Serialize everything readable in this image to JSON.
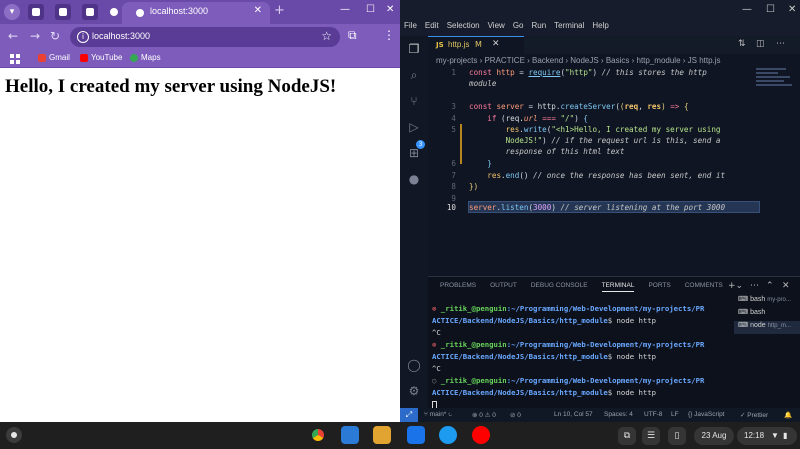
{
  "browser": {
    "tab_title": "localhost:3000",
    "new_tab": "+",
    "url": "localhost:3000",
    "bookmarks": [
      {
        "label": "Gmail",
        "color": "#ea4335"
      },
      {
        "label": "YouTube",
        "color": "#ff0000"
      },
      {
        "label": "Maps",
        "color": "#34a853"
      }
    ],
    "page_heading": "Hello, I created my server using NodeJS!"
  },
  "vscode": {
    "menu": [
      "File",
      "Edit",
      "Selection",
      "View",
      "Go",
      "Run",
      "Terminal",
      "Help"
    ],
    "tab": {
      "icon": "JS",
      "name": "http.js",
      "modified": "M"
    },
    "breadcrumb": "my-projects › PRACTICE › Backend › NodeJS › Basics › http_module › JS http.js",
    "line_numbers": [
      "1",
      "",
      "3",
      "4",
      "5",
      "",
      "",
      "6",
      "7",
      "8",
      "9",
      "10"
    ],
    "panel_tabs": [
      "PROBLEMS",
      "OUTPUT",
      "DEBUG CONSOLE",
      "TERMINAL",
      "PORTS",
      "COMMENTS"
    ],
    "terminal": {
      "user": "_ritik_@penguin",
      "path1": ":~/Programming/Web-Development/my-projects/PR",
      "path2": "ACTICE/Backend/NodeJS/Basics/http_module",
      "prompt_end": "$ ",
      "cmd": "node http",
      "ctrl_c": "^C"
    },
    "sessions": [
      {
        "name": "bash",
        "sub": "my-pro..."
      },
      {
        "name": "bash",
        "sub": ""
      },
      {
        "name": "node",
        "sub": "http_m..."
      }
    ],
    "status": {
      "remote": "⤢",
      "branch": "main*",
      "errors": "⊗ 0 ⚠ 0",
      "ports": "⊘ 0",
      "position": "Ln 10, Col 57",
      "spaces": "Spaces: 4",
      "encoding": "UTF-8",
      "eol": "LF",
      "language": "{} JavaScript",
      "prettier": "✓ Prettier",
      "bell": "🔔"
    }
  },
  "shelf": {
    "date": "23 Aug",
    "time": "12:18"
  },
  "colors": {
    "chrome_purple": "#7d5cbc",
    "editor_bg": "#0f1522",
    "keyword": "#ff7b9c",
    "string": "#b5e28c"
  }
}
